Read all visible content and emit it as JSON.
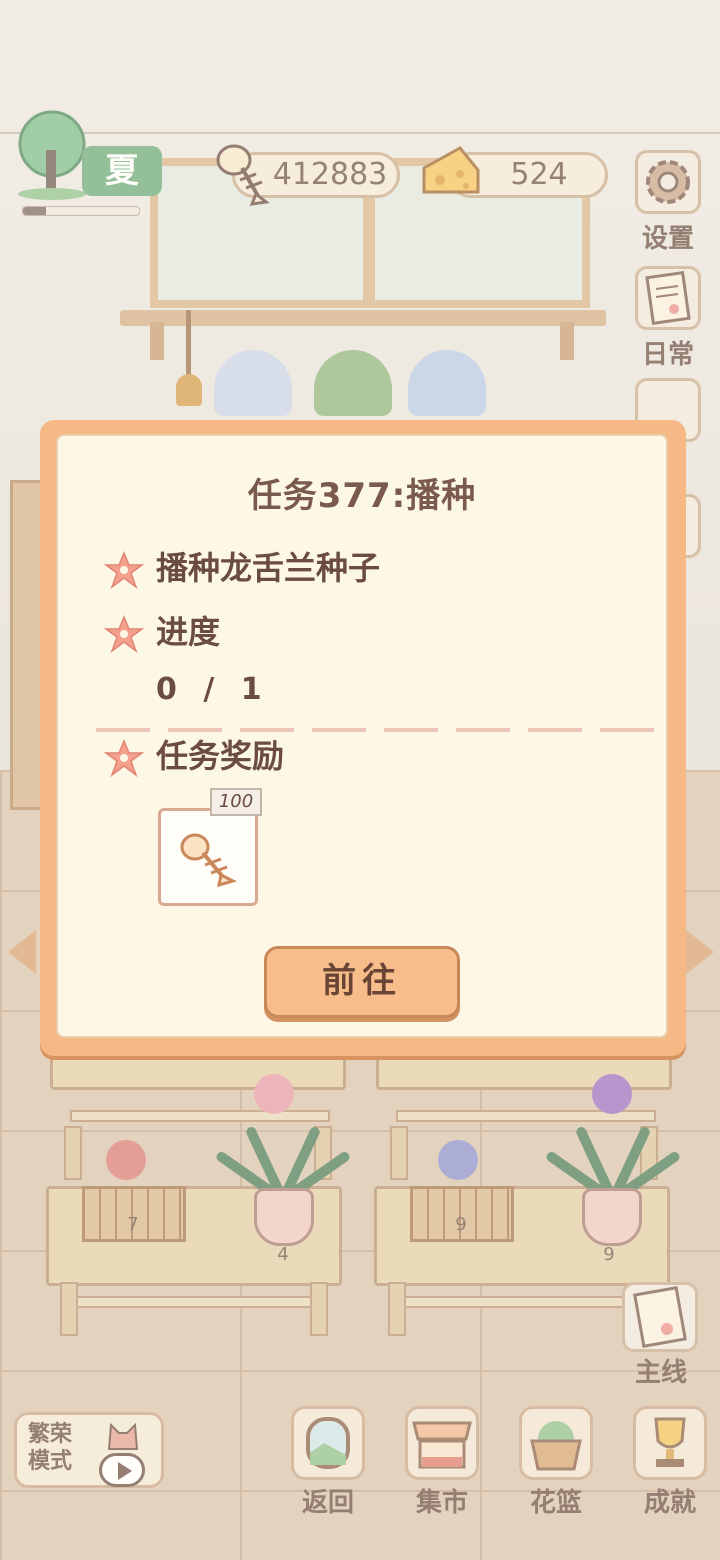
{
  "hud": {
    "season_label": "夏",
    "season_progress": 0.2,
    "fishbone_count": "412883",
    "cheese_count": "524"
  },
  "side_buttons": [
    {
      "label": "设置",
      "icon": "gear-icon"
    },
    {
      "label": "日常",
      "icon": "daily-note-icon"
    }
  ],
  "scene": {
    "pot_counts": [
      "4",
      "9"
    ],
    "crate_counts": [
      "7",
      "9"
    ]
  },
  "modal": {
    "title": "任务377:播种",
    "task_desc": "播种龙舌兰种子",
    "progress_label": "进度",
    "progress_value": "0 / 1",
    "progress_current": 0,
    "progress_total": 1,
    "reward_label": "任务奖励",
    "reward_amount": "100",
    "reward_icon": "fishbone-icon",
    "go_button": "前往"
  },
  "bottom_bar": {
    "prosper_mode": "繁荣模式",
    "mainline": "主线",
    "buttons": [
      {
        "label": "返回",
        "icon": "window-return-icon"
      },
      {
        "label": "集市",
        "icon": "market-stall-icon"
      },
      {
        "label": "花篮",
        "icon": "flower-basket-icon"
      },
      {
        "label": "成就",
        "icon": "trophy-icon"
      }
    ]
  },
  "colors": {
    "modal_frame": "#f6b985",
    "modal_body": "#fdf7e6",
    "accent_star": "#f09a87",
    "text": "#6a4c40"
  }
}
